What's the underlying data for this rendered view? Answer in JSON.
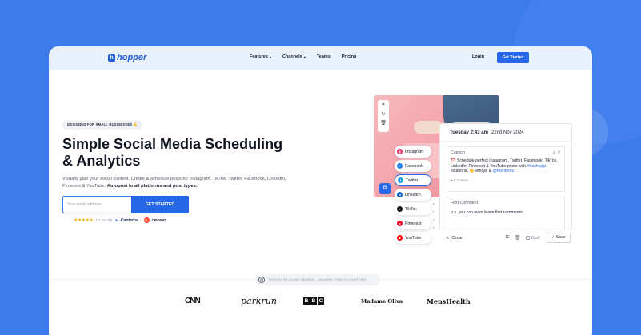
{
  "nav": {
    "logo_text": "hopper",
    "logo_mark": "h",
    "items": [
      {
        "label": "Features",
        "has_dropdown": true
      },
      {
        "label": "Channels",
        "has_dropdown": true
      },
      {
        "label": "Teams",
        "has_dropdown": false
      },
      {
        "label": "Pricing",
        "has_dropdown": false
      }
    ],
    "login": "Login",
    "get_started": "Get Started"
  },
  "hero": {
    "badge": "DESIGNED FOR SMALL BUSINESSES 💪",
    "headline_line1": "Simple Social Media Scheduling",
    "headline_line2": "& Analytics",
    "subtext": "Visually plan your social content. Create & schedule posts for Instagram, TikTok, Twitter, Facebook, LinkedIn, Pinterest & YouTube.",
    "subtext_bold": "Autopost to all platforms and post types.",
    "email_placeholder": "Your email address",
    "cta": "GET STARTED",
    "stars": "★★★★★",
    "rating": "4.7 out of 5",
    "capterra": "Capterra",
    "crowd": "CROWD",
    "g2": "G"
  },
  "mockup": {
    "channels": [
      {
        "name": "Instagram",
        "color": "#e1306c",
        "glyph": "◎",
        "active": false
      },
      {
        "name": "Facebook",
        "color": "#1877f2",
        "glyph": "f",
        "active": false
      },
      {
        "name": "Twitter",
        "color": "#1da1f2",
        "glyph": "t",
        "active": true
      },
      {
        "name": "LinkedIn",
        "color": "#0a66c2",
        "glyph": "in",
        "active": false
      },
      {
        "name": "TikTok",
        "color": "#111111",
        "glyph": "♪",
        "active": false
      },
      {
        "name": "Pinterest",
        "color": "#e60023",
        "glyph": "p",
        "active": false
      },
      {
        "name": "YouTube",
        "color": "#ff0000",
        "glyph": "▶",
        "active": false
      }
    ],
    "time": "Tuesday 2:43 am",
    "date": "22nd Nov 2024",
    "caption_label": "Caption",
    "caption_text": "⏰ Schedule perfect Instagram, Twitter, Facebook, TikTok, LinkedIn, Pinterest & YouTube posts with",
    "caption_hashtags": "#hashtags",
    "caption_mid": "locations, 👏 emojis &",
    "caption_mentions": "@mentions.",
    "location": "Location",
    "first_comment_label": "First Comment",
    "first_comment_text": "p.s. you can even leave first comments",
    "close": "Close",
    "draft": "Draft",
    "save": "Save"
  },
  "trusted": {
    "text": "TRUSTED BY 15,000+ BRANDS — IN MORE THAN 70 COUNTRIES",
    "logos": [
      "CNN",
      "parkrun",
      "BBC",
      "Madame Oliva",
      "MensHealth"
    ]
  },
  "colors": {
    "background": "#3b7bea",
    "primary": "#2568e8",
    "star": "#f2b01e"
  }
}
